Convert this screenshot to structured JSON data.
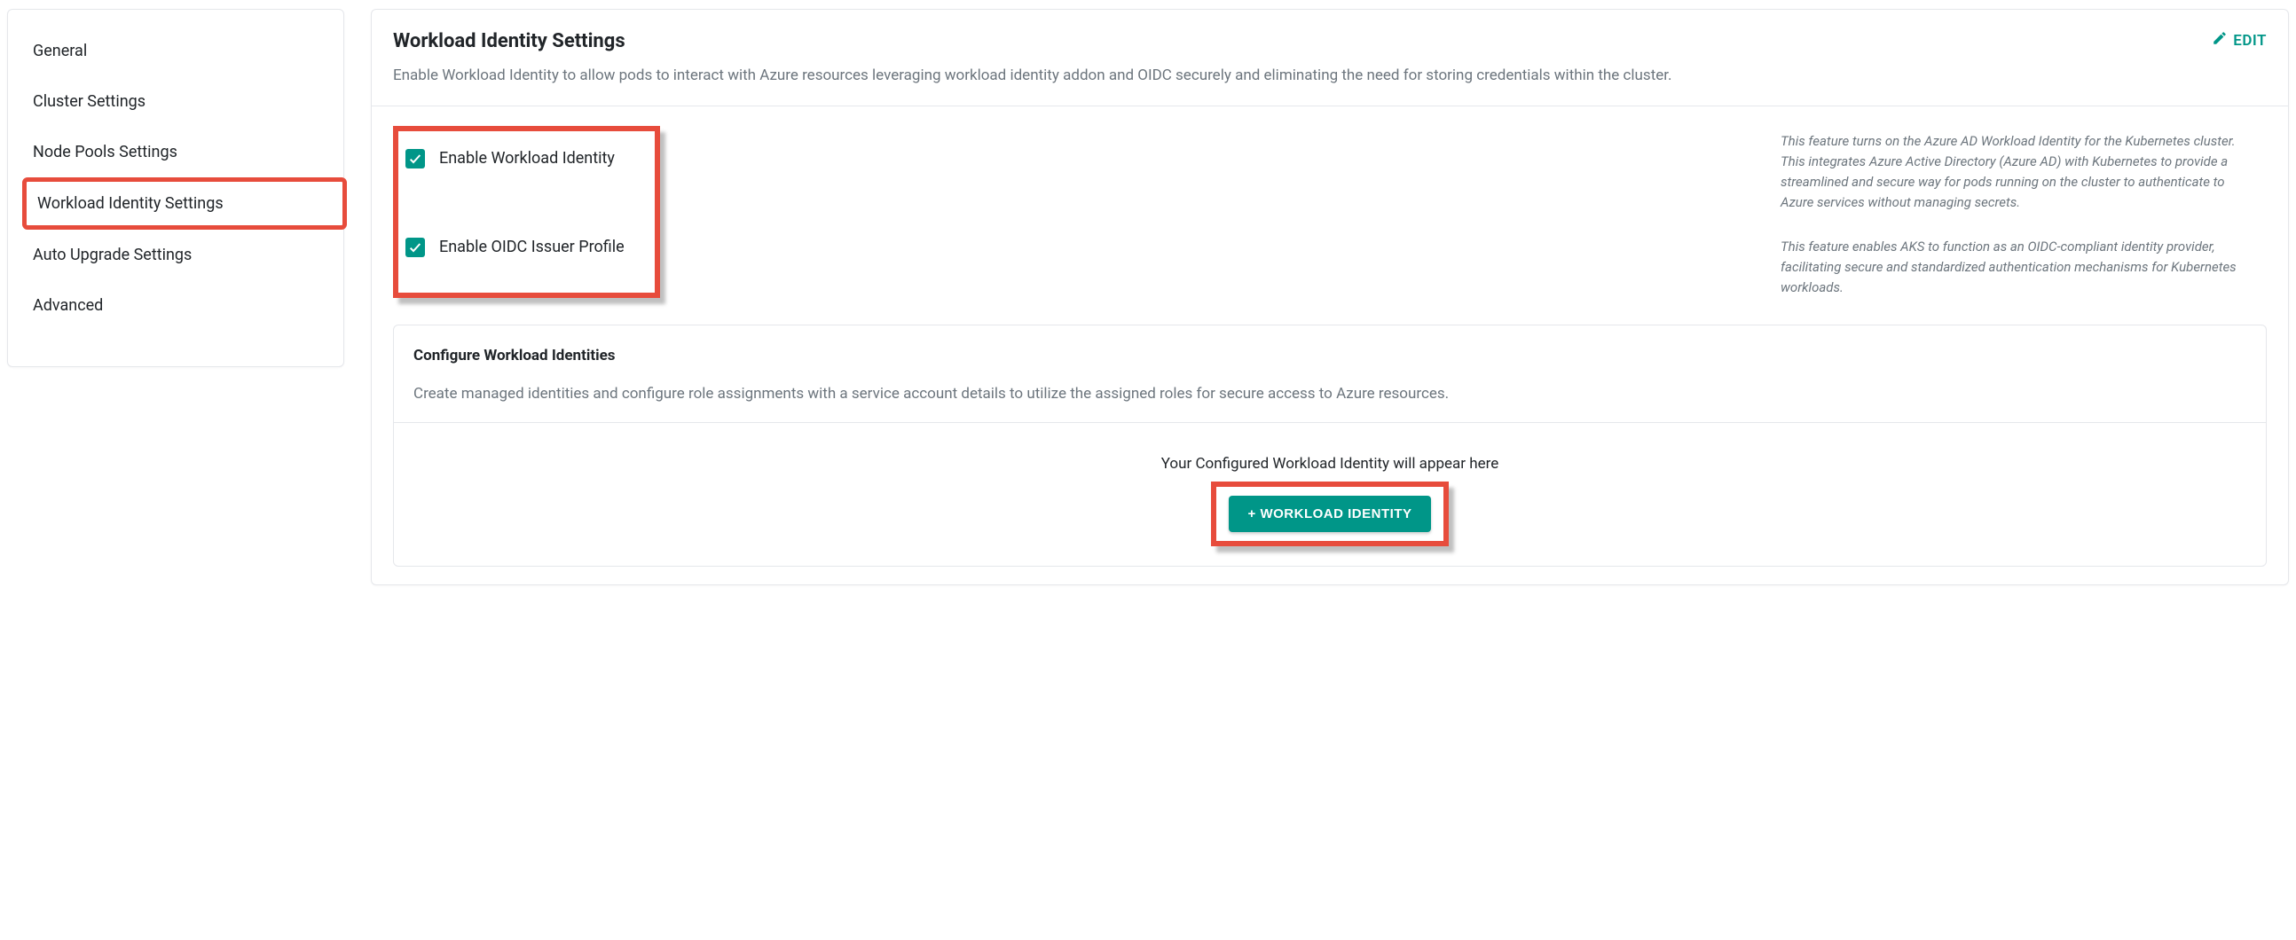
{
  "sidebar": {
    "items": [
      {
        "label": "General"
      },
      {
        "label": "Cluster Settings"
      },
      {
        "label": "Node Pools Settings"
      },
      {
        "label": "Workload Identity Settings"
      },
      {
        "label": "Auto Upgrade Settings"
      },
      {
        "label": "Advanced"
      }
    ],
    "active_index": 3
  },
  "header": {
    "title": "Workload Identity Settings",
    "edit_label": "EDIT",
    "description": "Enable Workload Identity to allow pods to interact with Azure resources leveraging workload identity addon and OIDC securely and eliminating the need for storing credentials within the cluster."
  },
  "settings": {
    "checkboxes": [
      {
        "label": "Enable Workload Identity",
        "checked": true,
        "help": "This feature turns on the Azure AD Workload Identity for the Kubernetes cluster. This integrates Azure Active Directory (Azure AD) with Kubernetes to provide a streamlined and secure way for pods running on the cluster to authenticate to Azure services without managing secrets."
      },
      {
        "label": "Enable OIDC Issuer Profile",
        "checked": true,
        "help": "This feature enables AKS to function as an OIDC-compliant identity provider, facilitating secure and standardized authentication mechanisms for Kubernetes workloads."
      }
    ]
  },
  "configure": {
    "title": "Configure Workload Identities",
    "description": "Create managed identities and configure role assignments with a service account details to utilize the assigned roles for secure access to Azure resources.",
    "empty_text": "Your Configured Workload Identity will appear here",
    "add_button_label": "+ WORKLOAD IDENTITY"
  }
}
